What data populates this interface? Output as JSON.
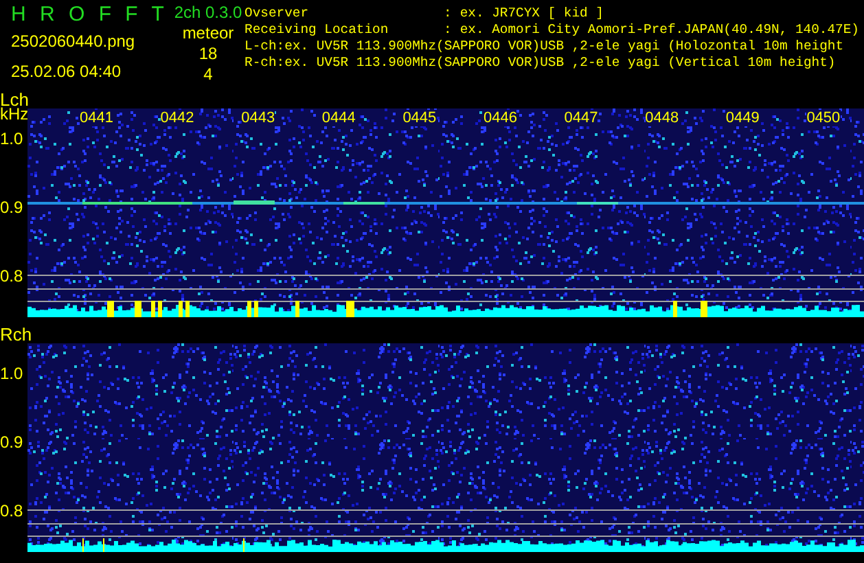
{
  "app": {
    "title": "H R O F F T",
    "version": "2ch 0.3.0",
    "filename": "2502060440.png",
    "datetime": "25.02.06 04:40"
  },
  "meteor": {
    "label": "meteor",
    "counts": [
      "18",
      "4"
    ]
  },
  "info": [
    {
      "kind": "field",
      "label": "Ovserver",
      "separator": ":",
      "value": "ex. JR7CYX [ kid ]"
    },
    {
      "kind": "field",
      "label": "Receiving Location",
      "separator": ":",
      "value": "ex. Aomori City Aomori-Pref.JAPAN(40.49N, 140.47E)"
    },
    {
      "kind": "line",
      "text": "L-ch:ex. UV5R 113.900Mhz(SAPPORO VOR)USB ,2-ele yagi (Holozontal 10m height"
    },
    {
      "kind": "line",
      "text": "R-ch:ex. UV5R 113.900Mhz(SAPPORO VOR)USB ,2-ele yagi (Vertical 10m height)"
    }
  ],
  "channels": [
    {
      "label": "Lch",
      "unit": "kHz",
      "time_labels": [
        "0441",
        "0442",
        "0443",
        "0444",
        "0445",
        "0446",
        "0447",
        "0448",
        "0449",
        "0450"
      ],
      "yticks": [
        "1.0",
        "0.9",
        "0.8"
      ],
      "echo": true
    },
    {
      "label": "Rch",
      "yticks": [
        "1.0",
        "0.9",
        "0.8"
      ],
      "echo": false
    }
  ]
}
